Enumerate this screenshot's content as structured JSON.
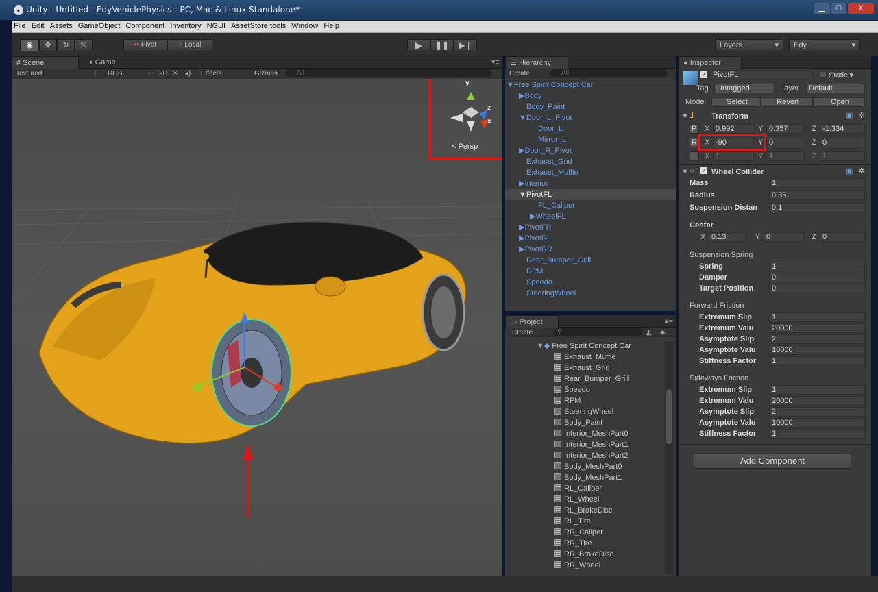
{
  "window": {
    "title": "Unity - Untitled - EdyVehiclePhysics - PC, Mac & Linux Standalone*",
    "min": "▁",
    "max": "□",
    "close": "X"
  },
  "menu": [
    "File",
    "Edit",
    "Assets",
    "GameObject",
    "Component",
    "Inventory",
    "NGUI",
    "AssetStore tools",
    "Window",
    "Help"
  ],
  "toolbar": {
    "pivot": "Pivot",
    "local": "Local",
    "layers": "Layers",
    "layout": "Edy"
  },
  "scene": {
    "tab_scene": "Scene",
    "tab_game": "Game",
    "shading": "Textured",
    "rgb": "RGB",
    "mode2d": "2D",
    "effects": "Effects",
    "gizmos": "Gizmos",
    "search": "All",
    "persp": "< Persp",
    "gizmo_y": "y",
    "gizmo_z": "z",
    "gizmo_x": "x"
  },
  "hierarchy": {
    "title": "Hierarchy",
    "create": "Create",
    "search": "All",
    "items": [
      {
        "label": "Free Spirit Concept Car",
        "arrow": "▼"
      },
      {
        "label": "Body",
        "arrow": "▶"
      },
      {
        "label": "Body_Paint",
        "arrow": ""
      },
      {
        "label": "Door_L_Pivot",
        "arrow": "▼"
      },
      {
        "label": "Door_L",
        "arrow": ""
      },
      {
        "label": "Mirror_L",
        "arrow": ""
      },
      {
        "label": "Door_R_Pivot",
        "arrow": "▶"
      },
      {
        "label": "Exhaust_Grid",
        "arrow": ""
      },
      {
        "label": "Exhaust_Muffle",
        "arrow": ""
      },
      {
        "label": "Interior",
        "arrow": "▶"
      },
      {
        "label": "PivotFL",
        "arrow": "▼"
      },
      {
        "label": "FL_Caliper",
        "arrow": ""
      },
      {
        "label": "WheelFL",
        "arrow": "▶"
      },
      {
        "label": "PivotFR",
        "arrow": "▶"
      },
      {
        "label": "PivotRL",
        "arrow": "▶"
      },
      {
        "label": "PivotRR",
        "arrow": "▶"
      },
      {
        "label": "Rear_Bumper_Grill",
        "arrow": ""
      },
      {
        "label": "RPM",
        "arrow": ""
      },
      {
        "label": "Speedo",
        "arrow": ""
      },
      {
        "label": "SteeringWheel",
        "arrow": ""
      }
    ]
  },
  "project": {
    "title": "Project",
    "create": "Create",
    "root": "Free Spirit Concept Car",
    "items": [
      "Exhaust_Muffle",
      "Exhaust_Grid",
      "Rear_Bumper_Grill",
      "Speedo",
      "RPM",
      "SteeringWheel",
      "Body_Paint",
      "Interior_MeshPart0",
      "Interior_MeshPart1",
      "Interior_MeshPart2",
      "Body_MeshPart0",
      "Body_MeshPart1",
      "RL_Caliper",
      "RL_Wheel",
      "RL_BrakeDisc",
      "RL_Tire",
      "RR_Caliper",
      "RR_Tire",
      "RR_BrakeDisc",
      "RR_Wheel"
    ]
  },
  "inspector": {
    "title": "Inspector",
    "object_name": "PivotFL",
    "static": "Static",
    "tag_label": "Tag",
    "tag": "Untagged",
    "layer_label": "Layer",
    "layer": "Default",
    "model_label": "Model",
    "select": "Select",
    "revert": "Revert",
    "open": "Open",
    "transform": {
      "title": "Transform",
      "p": "P",
      "r": "R",
      "s": "S",
      "pos": {
        "x": "0.992",
        "y": "0.357",
        "z": "-1.334"
      },
      "rot": {
        "x": "-90",
        "y": "0",
        "z": "0"
      },
      "scale": {
        "x": "1",
        "y": "1",
        "z": "1"
      }
    },
    "wheel": {
      "title": "Wheel Collider",
      "mass_label": "Mass",
      "mass": "1",
      "radius_label": "Radius",
      "radius": "0.35",
      "susp_dist_label": "Suspension Distan",
      "susp_dist": "0.1",
      "center_label": "Center",
      "cx": "0.13",
      "cy": "0",
      "cz": "0",
      "spring_header": "Suspension Spring",
      "spring_label": "Spring",
      "spring": "1",
      "damper_label": "Damper",
      "damper": "0",
      "target_label": "Target Position",
      "target": "0",
      "forward_header": "Forward Friction",
      "sideways_header": "Sideways Friction",
      "ext_slip_label": "Extremum Slip",
      "ext_val_label": "Extremum Valu",
      "asy_slip_label": "Asymptote Slip",
      "asy_val_label": "Asymptote Valu",
      "stiff_label": "Stiffness Factor",
      "fwd": {
        "ext_slip": "1",
        "ext_val": "20000",
        "asy_slip": "2",
        "asy_val": "10000",
        "stiff": "1"
      },
      "side": {
        "ext_slip": "1",
        "ext_val": "20000",
        "asy_slip": "2",
        "asy_val": "10000",
        "stiff": "1"
      }
    },
    "add_component": "Add Component"
  },
  "colors": {
    "selection_text": "#6a9eec",
    "highlight": "#e01717",
    "car": "#e3a21a"
  }
}
